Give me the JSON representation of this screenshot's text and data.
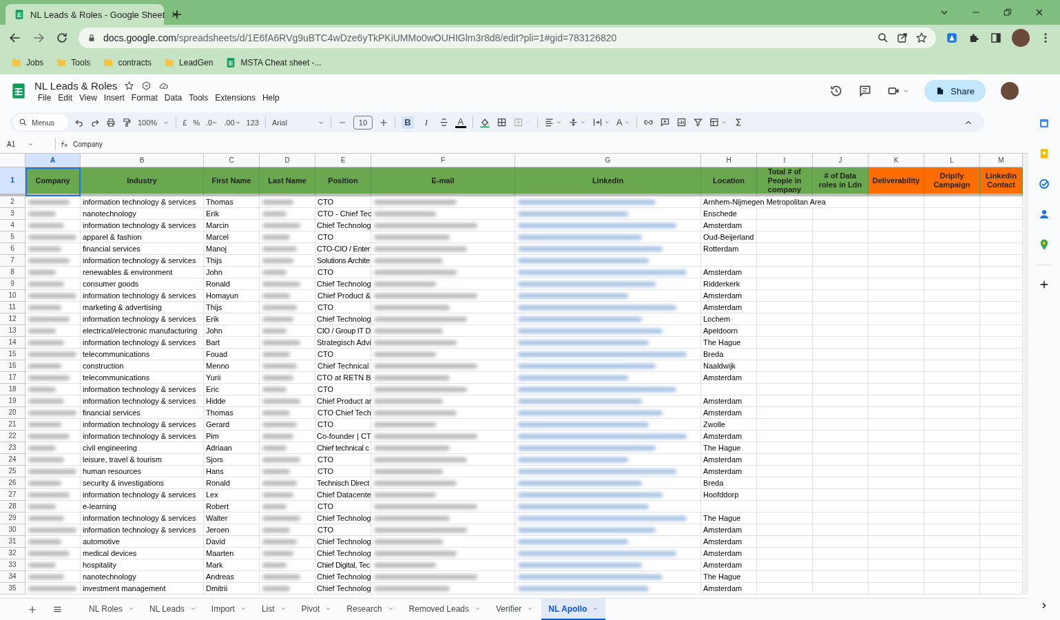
{
  "browser": {
    "tab_title": "NL Leads & Roles - Google Sheet",
    "url_host": "docs.google.com",
    "url_path": "/spreadsheets/d/1E6fA6RVg9uBTC4wDze6yTkPKiUMMo0wOUHIGlm3r8d8/edit?pli=1#gid=783126820",
    "bookmarks": [
      {
        "label": "Jobs",
        "kind": "folder"
      },
      {
        "label": "Tools",
        "kind": "folder"
      },
      {
        "label": "contracts",
        "kind": "folder"
      },
      {
        "label": "LeadGen",
        "kind": "folder"
      },
      {
        "label": "MSTA Cheat sheet -...",
        "kind": "sheet"
      }
    ]
  },
  "document": {
    "title": "NL Leads & Roles",
    "menu": [
      "File",
      "Edit",
      "View",
      "Insert",
      "Format",
      "Data",
      "Tools",
      "Extensions",
      "Help"
    ],
    "share": "Share"
  },
  "toolbar": {
    "search_placeholder": "Menus",
    "zoom": "100%",
    "currency": "£",
    "percent": "%",
    "decimal_decrease": ".0",
    "decimal_increase": ".00",
    "number_format": "123",
    "font": "Arial",
    "font_size": "10",
    "bold": {
      "label": "B",
      "active": true
    },
    "italic": "I",
    "text_color": "A",
    "text_rotation": "A"
  },
  "formula_bar": {
    "cell": "A1",
    "formula": "Company"
  },
  "columns": [
    {
      "letter": "A",
      "selected": true
    },
    {
      "letter": "B",
      "selected": false
    },
    {
      "letter": "C",
      "selected": false
    },
    {
      "letter": "D",
      "selected": false
    },
    {
      "letter": "E",
      "selected": false
    },
    {
      "letter": "F",
      "selected": false
    },
    {
      "letter": "G",
      "selected": false
    },
    {
      "letter": "H",
      "selected": false
    },
    {
      "letter": "I",
      "selected": false
    },
    {
      "letter": "J",
      "selected": false
    },
    {
      "letter": "K",
      "selected": false
    },
    {
      "letter": "L",
      "selected": false
    },
    {
      "letter": "M",
      "selected": false
    }
  ],
  "header_row": {
    "number": "1",
    "selected": true,
    "cells": [
      {
        "label": "Company",
        "color": "#6aa84f",
        "selected": true
      },
      {
        "label": "Industry",
        "color": "#6aa84f",
        "selected": false
      },
      {
        "label": "First Name",
        "color": "#6aa84f",
        "selected": false
      },
      {
        "label": "Last Name",
        "color": "#6aa84f",
        "selected": false
      },
      {
        "label": "Position",
        "color": "#6aa84f",
        "selected": false
      },
      {
        "label": "E-mail",
        "color": "#6aa84f",
        "selected": false
      },
      {
        "label": "Linkedin",
        "color": "#6aa84f",
        "selected": false
      },
      {
        "label": "Location",
        "color": "#6aa84f",
        "selected": false
      },
      {
        "label": "Total # of People in company",
        "color": "#6aa84f",
        "selected": false
      },
      {
        "label": "# of Data roles in Ldn",
        "color": "#6aa84f",
        "selected": false
      },
      {
        "label": "Deliverability",
        "color": "#ff6d01",
        "selected": false
      },
      {
        "label": "Dripify Campaign",
        "color": "#ff6d01",
        "selected": false
      },
      {
        "label": "Linkedin Contact",
        "color": "#ff6d01",
        "selected": false
      }
    ]
  },
  "rows": [
    {
      "row": "2",
      "industry": "information technology & services",
      "first_name": "Thomas",
      "position": "CTO",
      "location": "Arnhem-Nijmegen Metropolitan Area"
    },
    {
      "row": "3",
      "industry": "nanotechnology",
      "first_name": "Erik",
      "position": "CTO - Chief Tec",
      "location": "Enschede"
    },
    {
      "row": "4",
      "industry": "information technology & services",
      "first_name": "Marcin",
      "position": "Chief Technolog",
      "location": "Amsterdam"
    },
    {
      "row": "5",
      "industry": "apparel & fashion",
      "first_name": "Marcel",
      "position": "CTO",
      "location": "Oud-Beijerland"
    },
    {
      "row": "6",
      "industry": "financial services",
      "first_name": "Manoj",
      "position": "CTO-CIO / Enter",
      "location": "Rotterdam"
    },
    {
      "row": "7",
      "industry": "information technology & services",
      "first_name": "Thijs",
      "position": "Solutions Archite"
    },
    {
      "row": "8",
      "industry": "renewables & environment",
      "first_name": "John",
      "position": "CTO",
      "location": "Amsterdam"
    },
    {
      "row": "9",
      "industry": "consumer goods",
      "first_name": "Ronald",
      "position": "Chief Technolog",
      "location": "Ridderkerk"
    },
    {
      "row": "10",
      "industry": "information technology & services",
      "first_name": "Homayun",
      "position": "Chief Product &",
      "location": "Amsterdam"
    },
    {
      "row": "11",
      "industry": "marketing & advertising",
      "first_name": "Thijs",
      "position": "CTO",
      "location": "Amsterdam"
    },
    {
      "row": "12",
      "industry": "information technology & services",
      "first_name": "Erik",
      "position": "Chief Technolog",
      "location": "Lochem"
    },
    {
      "row": "13",
      "industry": "electrical/electronic manufacturing",
      "first_name": "John",
      "position": "CIO / Group IT D",
      "location": "Apeldoorn"
    },
    {
      "row": "14",
      "industry": "information technology & services",
      "first_name": "Bart",
      "position": "Strategisch Advi",
      "location": "The Hague"
    },
    {
      "row": "15",
      "industry": "telecommunications",
      "first_name": "Fouad",
      "position": "CTO",
      "location": "Breda"
    },
    {
      "row": "16",
      "industry": "construction",
      "first_name": "Menno",
      "position": "Chief Technical",
      "location": "Naaldwijk"
    },
    {
      "row": "17",
      "industry": "telecommunications",
      "first_name": "Yurii",
      "position": "CTO at RETN B",
      "location": "Amsterdam"
    },
    {
      "row": "18",
      "industry": "information technology & services",
      "first_name": "Eric",
      "position": "CTO"
    },
    {
      "row": "19",
      "industry": "information technology & services",
      "first_name": "Hidde",
      "position": "Chief Product ar",
      "location": "Amsterdam"
    },
    {
      "row": "20",
      "industry": "financial services",
      "first_name": "Thomas",
      "position": "CTO Chief Tech",
      "location": "Amsterdam"
    },
    {
      "row": "21",
      "industry": "information technology & services",
      "first_name": "Gerard",
      "position": "CTO",
      "location": "Zwolle"
    },
    {
      "row": "22",
      "industry": "information technology & services",
      "first_name": "Pim",
      "position": "Co-founder | CT",
      "location": "Amsterdam"
    },
    {
      "row": "23",
      "industry": "civil engineering",
      "first_name": "Adriaan",
      "position": "Chief technical c",
      "location": "The Hague"
    },
    {
      "row": "24",
      "industry": "leisure, travel & tourism",
      "first_name": "Sjors",
      "position": "CTO",
      "location": "Amsterdam"
    },
    {
      "row": "25",
      "industry": "human resources",
      "first_name": "Hans",
      "position": "CTO",
      "location": "Amsterdam"
    },
    {
      "row": "26",
      "industry": "security & investigations",
      "first_name": "Ronald",
      "position": "Technisch Direct",
      "location": "Breda"
    },
    {
      "row": "27",
      "industry": "information technology & services",
      "first_name": "Lex",
      "position": "Chief Datacente",
      "location": "Hoofddorp"
    },
    {
      "row": "28",
      "industry": "e-learning",
      "first_name": "Robert",
      "position": "CTO"
    },
    {
      "row": "29",
      "industry": "information technology & services",
      "first_name": "Walter",
      "position": "Chief Technolog",
      "location": "The Hague"
    },
    {
      "row": "30",
      "industry": "information technology & services",
      "first_name": "Jeroen",
      "position": "CTO",
      "location": "Amsterdam"
    },
    {
      "row": "31",
      "industry": "automotive",
      "first_name": "David",
      "position": "Chief Technolog",
      "location": "Amsterdam"
    },
    {
      "row": "32",
      "industry": "medical devices",
      "first_name": "Maarten",
      "position": "Chief Technolog",
      "location": "Amsterdam"
    },
    {
      "row": "33",
      "industry": "hospitality",
      "first_name": "Mark",
      "position": "Chief Digital, Tec",
      "location": "Amsterdam"
    },
    {
      "row": "34",
      "industry": "nanotechnology",
      "first_name": "Andreas",
      "position": "Chief Technolog",
      "location": "The Hague"
    },
    {
      "row": "35",
      "industry": "investment management",
      "first_name": "Dmitrii",
      "position": "Chief Technolog",
      "location": "Amsterdam"
    }
  ],
  "sheet_tabs": [
    {
      "label": "NL Roles",
      "selected": false
    },
    {
      "label": "NL Leads",
      "selected": false
    },
    {
      "label": "Import",
      "selected": false
    },
    {
      "label": "List",
      "selected": false
    },
    {
      "label": "Pivot",
      "selected": false
    },
    {
      "label": "Research",
      "selected": false
    },
    {
      "label": "Removed Leads",
      "selected": false
    },
    {
      "label": "Verifier",
      "selected": false
    },
    {
      "label": "NL Apollo",
      "selected": true
    }
  ]
}
